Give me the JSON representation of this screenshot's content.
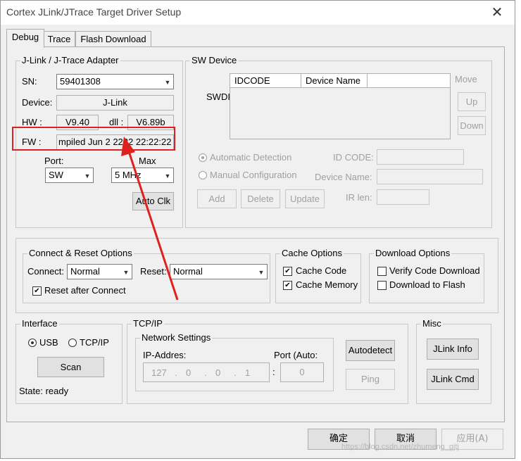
{
  "window": {
    "title": "Cortex JLink/JTrace Target Driver Setup",
    "close_glyph": "✕"
  },
  "tabs": [
    "Debug",
    "Trace",
    "Flash Download"
  ],
  "adapter": {
    "group_label": "J-Link / J-Trace Adapter",
    "sn_label": "SN:",
    "sn_value": "59401308",
    "device_label": "Device:",
    "device_value": "J-Link",
    "hw_label": "HW :",
    "hw_value": "V9.40",
    "dll_label": "dll :",
    "dll_value": "V6.89b",
    "fw_label": "FW :",
    "fw_value": "mpiled Jun  2 2222 22:22:22",
    "port_label": "Port:",
    "port_value": "SW",
    "max_label": "Max",
    "max_value": "5 MHz",
    "autoclk_label": "Auto Clk"
  },
  "sw_device": {
    "group_label": "SW Device",
    "swdi_label": "SWDI",
    "columns": [
      "IDCODE",
      "Device Name"
    ],
    "move_label": "Move",
    "up_label": "Up",
    "down_label": "Down",
    "auto_detect_label": "Automatic Detection",
    "manual_config_label": "Manual Configuration",
    "idcode_label": "ID CODE:",
    "device_name_label": "Device Name:",
    "ir_len_label": "IR len:",
    "add_label": "Add",
    "delete_label": "Delete",
    "update_label": "Update"
  },
  "connect": {
    "group_label": "Connect & Reset Options",
    "connect_label": "Connect:",
    "connect_value": "Normal",
    "reset_label": "Reset:",
    "reset_value": "Normal",
    "reset_after_label": "Reset after Connect"
  },
  "cache": {
    "group_label": "Cache Options",
    "code_label": "Cache Code",
    "memory_label": "Cache Memory"
  },
  "download": {
    "group_label": "Download Options",
    "verify_label": "Verify Code Download",
    "flash_label": "Download to Flash"
  },
  "interface": {
    "group_label": "Interface",
    "usb_label": "USB",
    "tcpip_label": "TCP/IP",
    "scan_label": "Scan",
    "state_text": "State: ready"
  },
  "tcpip": {
    "group_label": "TCP/IP",
    "network_label": "Network Settings",
    "ip_label": "IP-Addres:",
    "ip_parts": [
      "127",
      "0",
      "0",
      "1"
    ],
    "port_label": "Port (Auto:",
    "port_value": "0",
    "autodetect_label": "Autodetect",
    "ping_label": "Ping"
  },
  "misc": {
    "group_label": "Misc",
    "jlink_info_label": "JLink Info",
    "jlink_cmd_label": "JLink Cmd"
  },
  "footer": {
    "ok": "确定",
    "cancel": "取消",
    "apply": "应用(A)",
    "watermark": "https://blog.csdn.net/zhumeng_gjtj"
  },
  "colors": {
    "highlight": "#e02020",
    "dialog_bg": "#f0f0f0"
  }
}
